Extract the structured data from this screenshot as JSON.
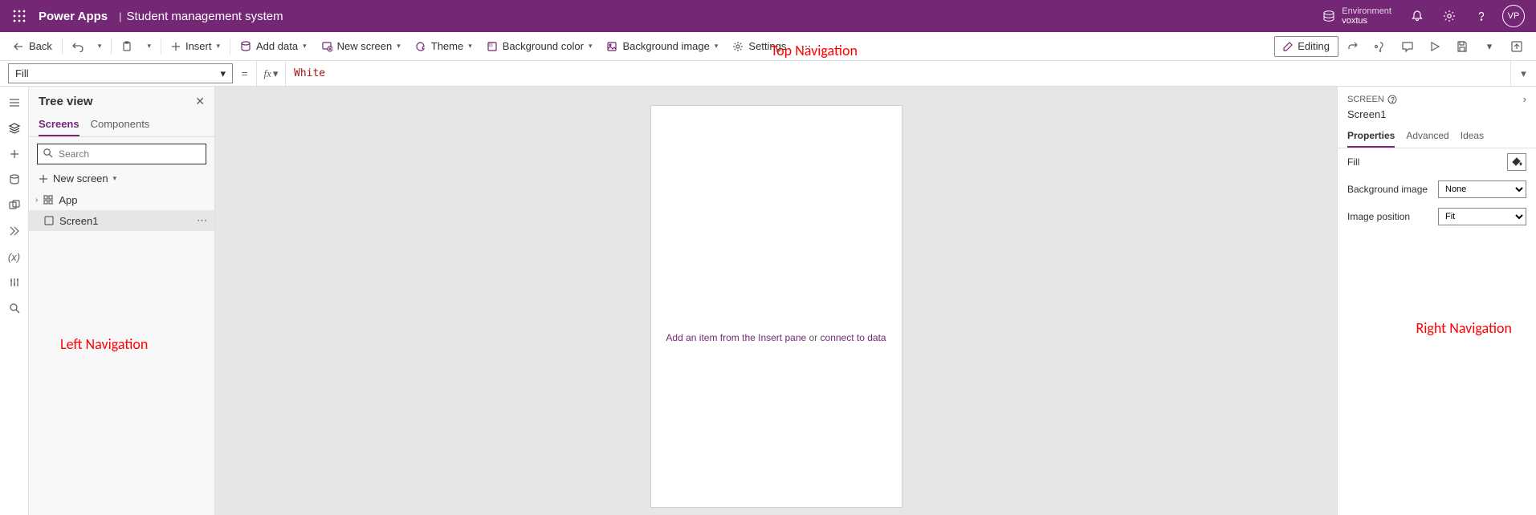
{
  "header": {
    "brand": "Power Apps",
    "appname": "Student management system",
    "env_label": "Environment",
    "env_name": "voxtus",
    "avatar": "VP"
  },
  "toolbar": {
    "back": "Back",
    "insert": "Insert",
    "add_data": "Add data",
    "new_screen": "New screen",
    "theme": "Theme",
    "bg_color": "Background color",
    "bg_image": "Background image",
    "settings": "Settings",
    "editing": "Editing"
  },
  "annotations": {
    "top": "Top Navigation",
    "left": "Left Navigation",
    "right": "Right Navigation"
  },
  "formula": {
    "property": "Fill",
    "value": "White"
  },
  "tree": {
    "title": "Tree view",
    "tab_screens": "Screens",
    "tab_components": "Components",
    "search_placeholder": "Search",
    "new_screen": "New screen",
    "app": "App",
    "screen": "Screen1"
  },
  "canvas": {
    "placeholder_a": "Add an item from the Insert pane",
    "placeholder_or": " or ",
    "placeholder_b": "connect to data"
  },
  "props": {
    "heading": "SCREEN",
    "name": "Screen1",
    "tab_props": "Properties",
    "tab_adv": "Advanced",
    "tab_ideas": "Ideas",
    "fill": "Fill",
    "bg_image": "Background image",
    "bg_image_val": "None",
    "img_pos": "Image position",
    "img_pos_val": "Fit"
  }
}
